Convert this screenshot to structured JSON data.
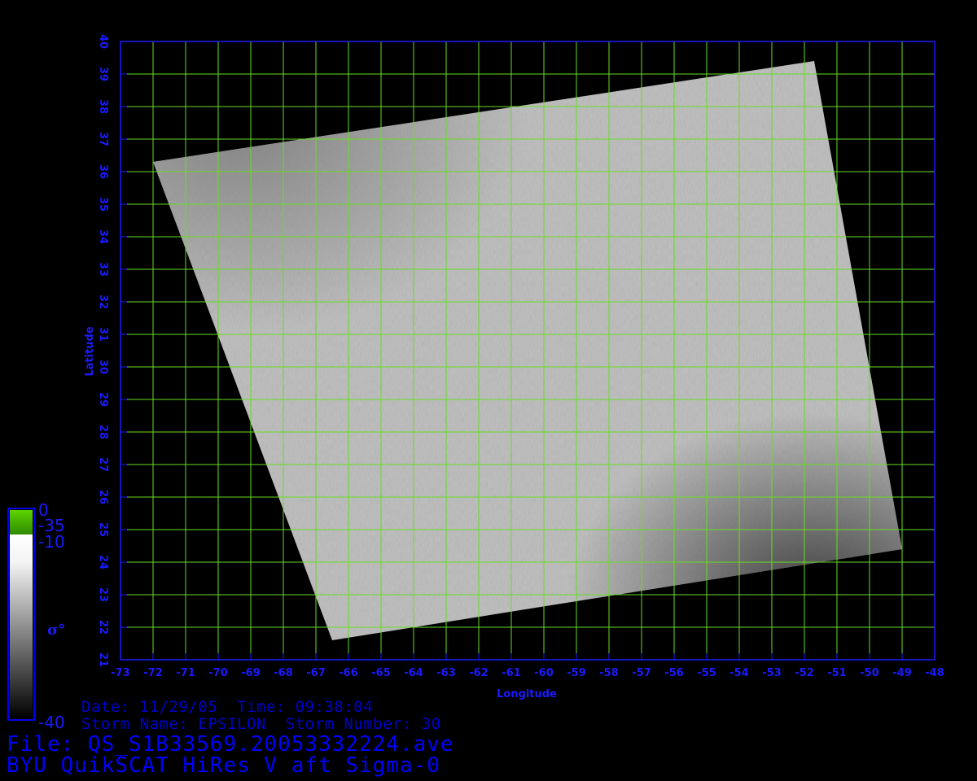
{
  "map": {
    "lon_range": [
      -73,
      -48
    ],
    "lat_range": [
      21,
      40
    ],
    "lon_ticks": [
      "-73",
      "-72",
      "-71",
      "-70",
      "-69",
      "-68",
      "-67",
      "-66",
      "-65",
      "-64",
      "-63",
      "-62",
      "-61",
      "-60",
      "-59",
      "-58",
      "-57",
      "-56",
      "-55",
      "-54",
      "-53",
      "-52",
      "-51",
      "-50",
      "-49",
      "-48"
    ],
    "lat_ticks": [
      "21",
      "22",
      "23",
      "24",
      "25",
      "26",
      "27",
      "28",
      "29",
      "30",
      "31",
      "32",
      "33",
      "34",
      "35",
      "36",
      "37",
      "38",
      "39",
      "40"
    ],
    "xlabel": "Longitude",
    "ylabel": "Latitude",
    "grid_color": "#66dd22",
    "frame_color": "#1a1aff",
    "swath_corners_lonlat": [
      [
        -72,
        36.3
      ],
      [
        -51.7,
        39.4
      ],
      [
        -49,
        24.4
      ],
      [
        -66.5,
        21.6
      ]
    ]
  },
  "colorbar": {
    "label": "σ°",
    "top_value": "0",
    "land_value": "-35",
    "upper_value": "-10",
    "bottom_value": "-40",
    "land_color": "#3fa300"
  },
  "info": {
    "date_time": "Date: 11/29/05  Time: 09:38:04",
    "storm": "Storm Name: EPSILON  Storm Number: 30",
    "file": "File: QS_S1B33569.20053332224.ave",
    "product": "BYU QuikSCAT HiRes V aft Sigma-0"
  }
}
